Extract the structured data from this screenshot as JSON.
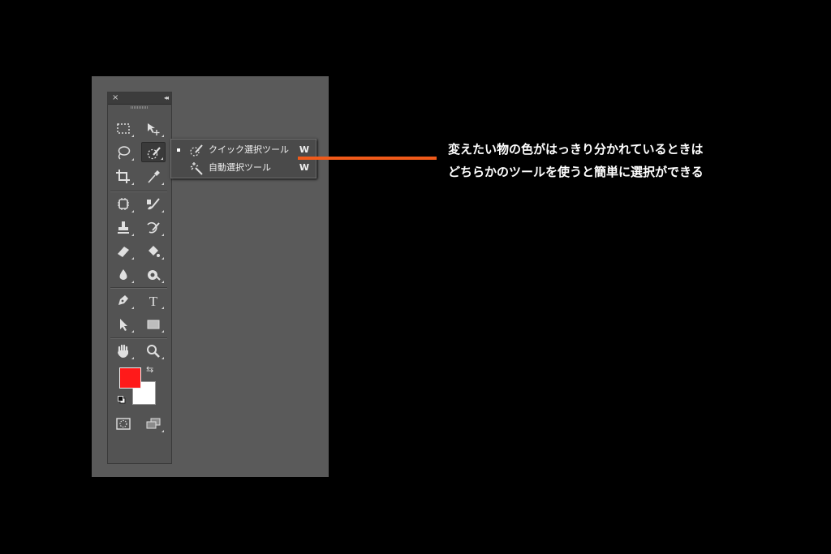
{
  "toolbox": {
    "close_glyph": "×",
    "collapse_glyph": "◂◂",
    "tools": [
      {
        "name": "rectangular-marquee-tool",
        "icon": "marquee-rect-icon"
      },
      {
        "name": "move-tool",
        "icon": "move-icon"
      },
      {
        "name": "lasso-tool",
        "icon": "lasso-icon"
      },
      {
        "name": "quick-selection-tool",
        "icon": "quick-selection-icon",
        "selected": true
      },
      {
        "name": "crop-tool",
        "icon": "crop-icon"
      },
      {
        "name": "eyedropper-tool",
        "icon": "eyedropper-icon"
      },
      {
        "name": "spot-healing-brush-tool",
        "icon": "spot-healing-icon"
      },
      {
        "name": "brush-tool",
        "icon": "brush-icon"
      },
      {
        "name": "clone-stamp-tool",
        "icon": "stamp-icon"
      },
      {
        "name": "history-brush-tool",
        "icon": "history-brush-icon"
      },
      {
        "name": "eraser-tool",
        "icon": "eraser-icon"
      },
      {
        "name": "paint-bucket-tool",
        "icon": "paint-bucket-icon"
      },
      {
        "name": "blur-tool",
        "icon": "blur-drop-icon"
      },
      {
        "name": "dodge-tool",
        "icon": "dodge-icon"
      },
      {
        "name": "pen-tool",
        "icon": "pen-icon"
      },
      {
        "name": "type-tool",
        "icon": "type-icon",
        "glyph": "T"
      },
      {
        "name": "path-selection-tool",
        "icon": "arrow-icon"
      },
      {
        "name": "rectangle-tool",
        "icon": "rectangle-icon"
      },
      {
        "name": "hand-tool",
        "icon": "hand-icon"
      },
      {
        "name": "zoom-tool",
        "icon": "zoom-icon"
      }
    ],
    "foreground_color": "#ff1a1a",
    "background_color": "#ffffff",
    "swap_glyph": "⇆",
    "quick_mask_icon": "quick-mask-icon",
    "screen_mode_icon": "screen-mode-icon"
  },
  "flyout": {
    "items": [
      {
        "label": "クイック選択ツール",
        "shortcut": "W",
        "active": true,
        "icon": "quick-selection-icon"
      },
      {
        "label": "自動選択ツール",
        "shortcut": "W",
        "active": false,
        "icon": "magic-wand-icon"
      }
    ]
  },
  "annotation": {
    "line1": "変えたい物の色がはっきり分かれているときは",
    "line2": "どちらかのツールを使うと簡単に選択ができる",
    "accent_color": "#f05a1a"
  }
}
